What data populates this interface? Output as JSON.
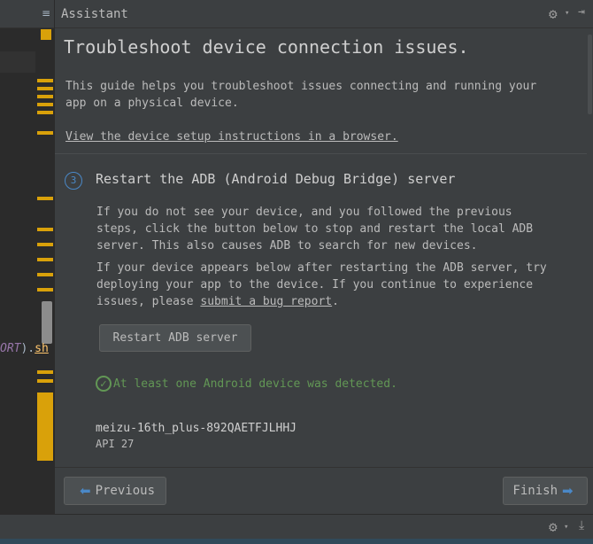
{
  "editor": {
    "menu_icon": "≡",
    "code_constant": "ORT",
    "code_paren": ").",
    "code_call": "sh"
  },
  "header": {
    "title": "Assistant",
    "gear_icon": "⚙",
    "caret_icon": "▾",
    "pin_icon": "⇥"
  },
  "guide": {
    "title": "Troubleshoot device connection issues.",
    "intro_line1": "This guide helps you troubleshoot issues connecting and running your",
    "intro_line2": "app on a physical device.",
    "setup_link": "View the device setup instructions in a browser.",
    "step": {
      "number": "3",
      "title": "Restart the ADB (Android Debug Bridge) server",
      "p1_line1": "If you do not see your device, and you followed the previous",
      "p1_line2": "steps, click the button below to stop and restart the local ADB",
      "p1_line3": "server. This also causes ADB to search for new devices.",
      "p2_line1": "If your device appears below after restarting the ADB server, try",
      "p2_line2": "deploying your app to the device. If you continue to experience",
      "p2_line3_prefix": "issues, please ",
      "p2_link": "submit a bug report",
      "p2_line3_suffix": ".",
      "restart_button": "Restart ADB server",
      "status_text": "At least one Android device was detected.",
      "device_name": "meizu-16th_plus-892QAETFJLHHJ",
      "device_api": "API 27"
    }
  },
  "footer": {
    "previous_label": "Previous",
    "finish_label": "Finish"
  },
  "bottom": {
    "gear_icon": "⚙",
    "caret_icon": "▾",
    "download_icon": "⤓"
  },
  "colors": {
    "accent": "#4a88c7",
    "success": "#629755",
    "marker": "#d9a10a"
  }
}
